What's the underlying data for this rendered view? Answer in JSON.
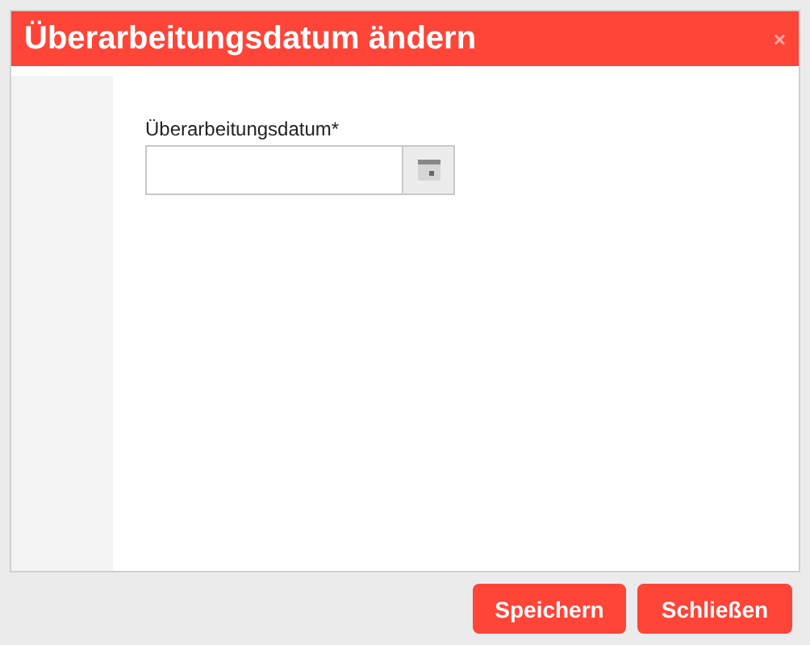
{
  "dialog": {
    "title": "Überarbeitungsdatum ändern",
    "close": "×"
  },
  "field": {
    "label": "Überarbeitungsdatum*"
  },
  "buttons": [
    {
      "label": "Speichern"
    },
    {
      "label": "Schließen"
    }
  ]
}
